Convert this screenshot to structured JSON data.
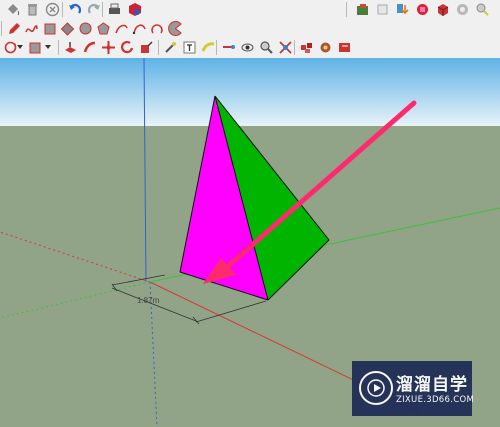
{
  "toolbar": {
    "row1": [
      {
        "id": "paint-bucket-tool",
        "icon": "paint-bucket-icon"
      },
      {
        "id": "delete-tool",
        "icon": "trash-icon"
      },
      {
        "id": "eraser-cancel",
        "icon": "circle-x-icon"
      },
      {
        "id": "undo",
        "icon": "undo-icon"
      },
      {
        "id": "redo",
        "icon": "redo-icon"
      },
      {
        "id": "print",
        "icon": "printer-icon"
      },
      {
        "id": "model-info",
        "icon": "model-info-icon"
      }
    ],
    "row1_right": [
      {
        "id": "get-models",
        "icon": "warehouse-icon"
      },
      {
        "id": "share-model",
        "icon": "share-icon"
      },
      {
        "id": "download",
        "icon": "download-icon"
      },
      {
        "id": "extension-1",
        "icon": "extension-red-icon"
      },
      {
        "id": "extension-2",
        "icon": "extension-cube-icon"
      },
      {
        "id": "extension-3",
        "icon": "extension-gray-icon"
      },
      {
        "id": "extension-4",
        "icon": "extension-lens-icon"
      }
    ],
    "row2": [
      {
        "id": "pencil-line",
        "icon": "pencil-icon"
      },
      {
        "id": "freehand",
        "icon": "freehand-icon"
      },
      {
        "id": "rectangle",
        "icon": "rectangle-icon"
      },
      {
        "id": "rotated-rectangle",
        "icon": "rotated-rectangle-icon"
      },
      {
        "id": "circle",
        "icon": "circle-icon"
      },
      {
        "id": "polygon",
        "icon": "polygon-icon"
      },
      {
        "id": "arc",
        "icon": "arc-icon"
      },
      {
        "id": "two-point-arc",
        "icon": "two-point-arc-icon"
      },
      {
        "id": "three-point-arc",
        "icon": "three-point-arc-icon"
      },
      {
        "id": "pie",
        "icon": "pie-icon"
      }
    ],
    "row3": [
      {
        "id": "orbit-dropdown",
        "icon": "orbit-icon"
      },
      {
        "id": "shape-dropdown",
        "icon": "rectangle-dropdown-icon"
      },
      {
        "id": "push-pull",
        "icon": "push-pull-icon"
      },
      {
        "id": "follow-me",
        "icon": "follow-me-icon"
      },
      {
        "id": "move",
        "icon": "move-icon"
      },
      {
        "id": "rotate",
        "icon": "rotate-icon"
      },
      {
        "id": "scale",
        "icon": "scale-icon"
      },
      {
        "id": "tape-measure",
        "icon": "tape-measure-icon"
      },
      {
        "id": "text",
        "icon": "text-icon"
      },
      {
        "id": "paint",
        "icon": "paint-icon"
      },
      {
        "id": "walk",
        "icon": "walk-icon"
      },
      {
        "id": "look-around",
        "icon": "look-around-icon"
      },
      {
        "id": "zoom",
        "icon": "zoom-icon"
      },
      {
        "id": "zoom-extents",
        "icon": "zoom-extents-icon"
      },
      {
        "id": "components",
        "icon": "components-icon"
      },
      {
        "id": "materials",
        "icon": "materials-icon"
      },
      {
        "id": "styles",
        "icon": "styles-icon"
      }
    ]
  },
  "viewport": {
    "dimension_label": "1.87m",
    "colors": {
      "sky_top": "#5fb2e6",
      "sky_bottom": "#e8f3f8",
      "ground": "#91a487",
      "face_front": "#ff00ff",
      "face_side": "#00b400",
      "edge": "#111111",
      "arrow": "#ff2a6e",
      "axis_red": "#d33a3a",
      "axis_green": "#3fbf3f",
      "axis_blue": "#3a5fd0"
    }
  },
  "watermark": {
    "title": "溜溜自学",
    "url": "ZIXUE.3D66.COM",
    "logo_icon": "play-logo-icon",
    "bg": "#1c2a55"
  }
}
